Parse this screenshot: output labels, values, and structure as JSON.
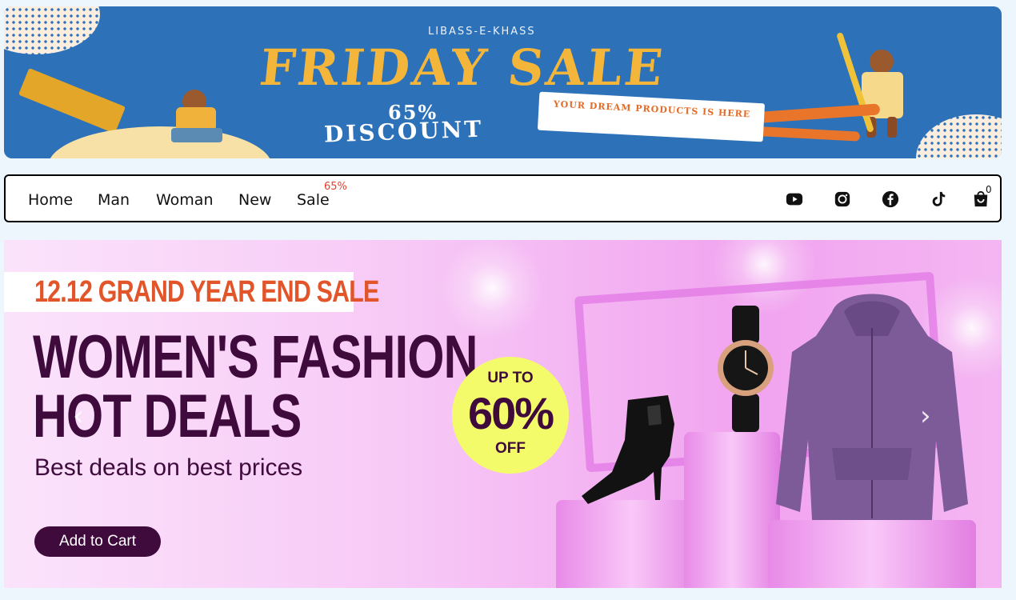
{
  "top_banner": {
    "brand": "LIBASS-E-KHASS",
    "title": "FRIDAY SALE",
    "discount_pct": "65%",
    "discount_word": "DISCOUNT",
    "tagline": "YOUR DREAM PRODUCTS IS HERE"
  },
  "nav": {
    "links": [
      "Home",
      "Man",
      "Woman",
      "New",
      "Sale"
    ],
    "sale_badge": "65%",
    "icons": [
      "youtube-icon",
      "instagram-icon",
      "facebook-icon",
      "tiktok-icon",
      "cart-icon"
    ],
    "cart_count": "0"
  },
  "hero": {
    "sale_label": "12.12 GRAND YEAR END SALE",
    "title_line1": "WOMEN'S FASHION",
    "title_line2": "HOT DEALS",
    "subtitle": "Best deals on best prices",
    "cart_button": "Add to Cart",
    "promo_up": "UP TO",
    "promo_pct": "60%",
    "promo_off": "OFF",
    "prev_arrow": "‹",
    "next_arrow": "›"
  },
  "colors": {
    "banner_blue": "#2d71b8",
    "banner_yellow": "#f4b63a",
    "hero_text": "#3f0a3c",
    "hero_orange": "#e2542a",
    "promo_yellow": "#f4fb6a",
    "sale_badge": "#e0402a"
  }
}
